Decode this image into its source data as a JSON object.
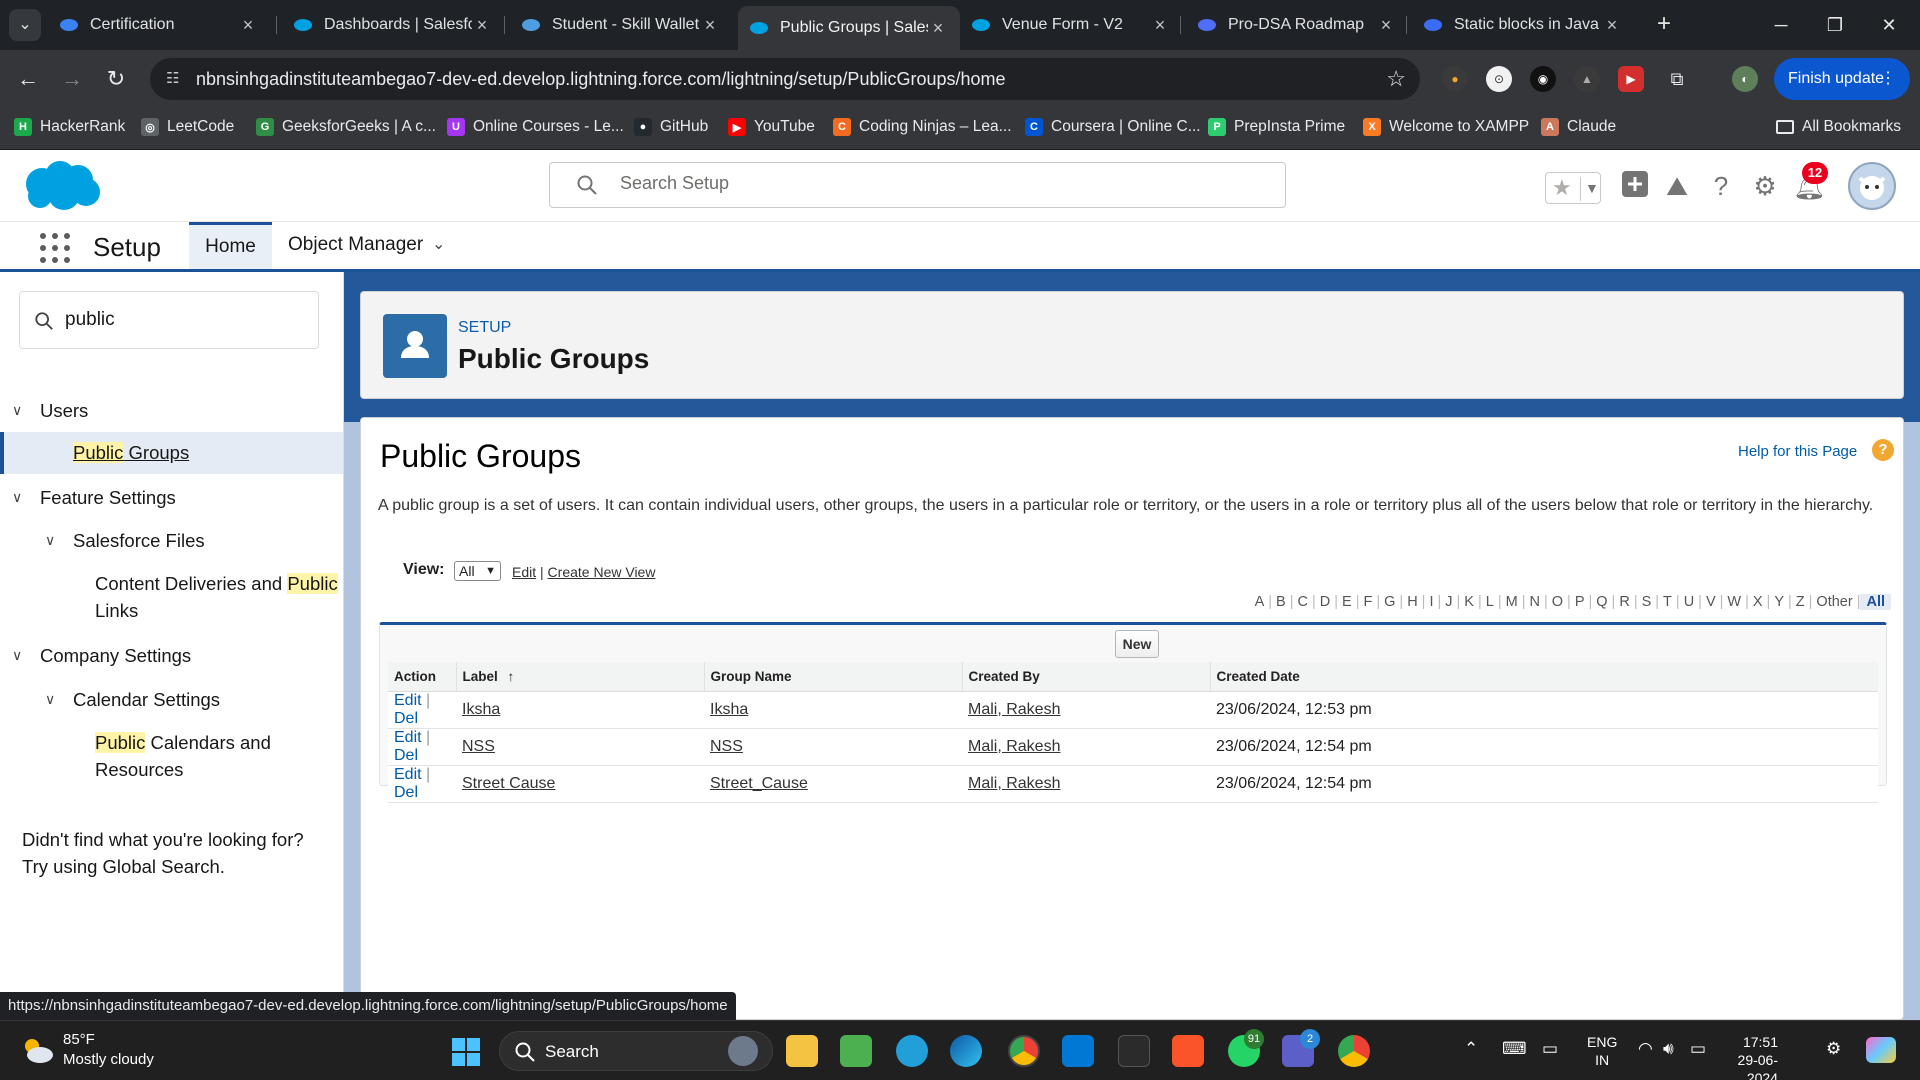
{
  "browser": {
    "tabs": [
      {
        "title": "Certification",
        "favicon": "trailhead-icon",
        "color": "#3b82f6"
      },
      {
        "title": "Dashboards | Salesfo",
        "favicon": "salesforce-cloud-icon",
        "color": "#00a1e0"
      },
      {
        "title": "Student - Skill Wallet",
        "favicon": "skill-wallet-icon",
        "color": "#4d9de0"
      },
      {
        "title": "Public Groups | Sales",
        "favicon": "salesforce-cloud-icon",
        "color": "#00a1e0"
      },
      {
        "title": "Venue Form - V2",
        "favicon": "salesforce-cloud-icon",
        "color": "#00a1e0"
      },
      {
        "title": "Pro-DSA Roadmap",
        "favicon": "chat-bubble-icon",
        "color": "#4f6ef7"
      },
      {
        "title": "Static blocks in Java",
        "favicon": "k-icon",
        "color": "#3b6cf6"
      }
    ],
    "active_tab_index": 3,
    "url": "nbnsinhgadinstituteambegao7-dev-ed.develop.lightning.force.com/lightning/setup/PublicGroups/home",
    "finish_update_label": "Finish update",
    "bookmarks": [
      {
        "label": "HackerRank",
        "icon": "hackerrank-icon",
        "color": "#1ba94c",
        "glyph": "H"
      },
      {
        "label": "LeetCode",
        "icon": "globe-icon",
        "color": "#5f6368",
        "glyph": "◎"
      },
      {
        "label": "GeeksforGeeks | A c...",
        "icon": "gfg-icon",
        "color": "#2f8d46",
        "glyph": "G"
      },
      {
        "label": "Online Courses - Le...",
        "icon": "udemy-icon",
        "color": "#a435f0",
        "glyph": "U"
      },
      {
        "label": "GitHub",
        "icon": "github-icon",
        "color": "#24292f",
        "glyph": "●"
      },
      {
        "label": "YouTube",
        "icon": "youtube-icon",
        "color": "#ff0000",
        "glyph": "▶"
      },
      {
        "label": "Coding Ninjas – Lea...",
        "icon": "coding-ninjas-icon",
        "color": "#f26b21",
        "glyph": "C"
      },
      {
        "label": "Coursera | Online C...",
        "icon": "coursera-icon",
        "color": "#0056d2",
        "glyph": "C"
      },
      {
        "label": "PrepInsta Prime",
        "icon": "prepinsta-icon",
        "color": "#2ecc71",
        "glyph": "P"
      },
      {
        "label": "Welcome to XAMPP",
        "icon": "xampp-icon",
        "color": "#fb7a24",
        "glyph": "X"
      },
      {
        "label": "Claude",
        "icon": "claude-icon",
        "color": "#cc785c",
        "glyph": "A"
      }
    ],
    "all_bookmarks_label": "All Bookmarks",
    "status_url": "https://nbnsinhgadinstituteambegao7-dev-ed.develop.lightning.force.com/lightning/setup/PublicGroups/home"
  },
  "sf_header": {
    "search_placeholder": "Search Setup",
    "notification_count": "12"
  },
  "setup_nav": {
    "app_title": "Setup",
    "home_tab": "Home",
    "object_manager_tab": "Object Manager"
  },
  "left_nav": {
    "quick_find_value": "public",
    "items": {
      "users": "Users",
      "public_groups_a": "Public",
      "public_groups_b": "Groups",
      "feature_settings": "Feature Settings",
      "salesforce_files": "Salesforce Files",
      "content_deliveries_a": "Content Deliveries and",
      "content_deliveries_b": "Public",
      "content_deliveries_c": "Links",
      "company_settings": "Company Settings",
      "calendar_settings": "Calendar Settings",
      "public_calendars_a": "Public",
      "public_calendars_b": "Calendars and",
      "public_calendars_c": "Resources"
    },
    "help_line1": "Didn't find what you're looking for?",
    "help_line2": "Try using Global Search."
  },
  "page_header": {
    "eyebrow": "SETUP",
    "title": "Public Groups"
  },
  "content": {
    "title": "Public Groups",
    "help_link": "Help for this Page",
    "description": "A public group is a set of users. It can contain individual users, other groups, the users in a particular role or territory, or the users in a role or territory plus all of the users below that role or territory in the hierarchy.",
    "view_label": "View:",
    "view_selected": "All",
    "edit_link": "Edit",
    "create_view_link": "Create New View",
    "alphabet": [
      "A",
      "B",
      "C",
      "D",
      "E",
      "F",
      "G",
      "H",
      "I",
      "J",
      "K",
      "L",
      "M",
      "N",
      "O",
      "P",
      "Q",
      "R",
      "S",
      "T",
      "U",
      "V",
      "W",
      "X",
      "Y",
      "Z",
      "Other",
      "All"
    ],
    "new_button": "New",
    "columns": [
      "Action",
      "Label",
      "Group Name",
      "Created By",
      "Created Date"
    ],
    "sort_indicator": "↑",
    "action_edit": "Edit",
    "action_del": "Del",
    "rows": [
      {
        "label": "Iksha",
        "group_name": "Iksha",
        "created_by": "Mali, Rakesh",
        "created_date": "23/06/2024, 12:53 pm"
      },
      {
        "label": "NSS",
        "group_name": "NSS",
        "created_by": "Mali, Rakesh",
        "created_date": "23/06/2024, 12:54 pm"
      },
      {
        "label": "Street Cause",
        "group_name": "Street_Cause",
        "created_by": "Mali, Rakesh",
        "created_date": "23/06/2024, 12:54 pm"
      }
    ]
  },
  "taskbar": {
    "weather_temp": "85°F",
    "weather_desc": "Mostly cloudy",
    "search_label": "Search",
    "whatsapp_badge": "91",
    "teams_badge": "2",
    "lang_line1": "ENG",
    "lang_line2": "IN",
    "time": "17:51",
    "date": "29-06-2024"
  },
  "colors": {
    "sf_brand": "#00a1e0",
    "setup_blue": "#1b5297",
    "link_blue": "#015ba7",
    "chrome_update_blue": "#0b57d0"
  }
}
